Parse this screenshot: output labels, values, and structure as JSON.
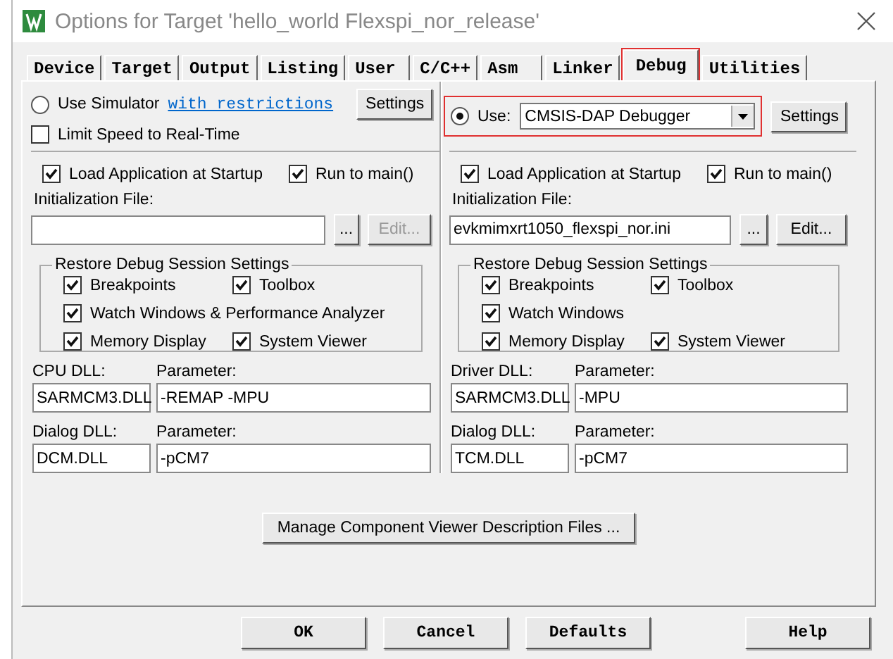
{
  "window": {
    "title": "Options for Target 'hello_world Flexspi_nor_release'"
  },
  "tabs": [
    {
      "label": "Device",
      "selected": false,
      "highlighted": false
    },
    {
      "label": "Target",
      "selected": false,
      "highlighted": false
    },
    {
      "label": "Output",
      "selected": false,
      "highlighted": false
    },
    {
      "label": "Listing",
      "selected": false,
      "highlighted": false
    },
    {
      "label": "User",
      "selected": false,
      "highlighted": false
    },
    {
      "label": "C/C++",
      "selected": false,
      "highlighted": false
    },
    {
      "label": "Asm",
      "selected": false,
      "highlighted": false
    },
    {
      "label": "Linker",
      "selected": false,
      "highlighted": false
    },
    {
      "label": "Debug",
      "selected": true,
      "highlighted": true
    },
    {
      "label": "Utilities",
      "selected": false,
      "highlighted": false
    }
  ],
  "columns": [
    {
      "top": {
        "kind": "simulator",
        "radio_label": "Use Simulator",
        "selected": false,
        "link": "with restrictions",
        "settings": "Settings",
        "limit_speed": {
          "label": "Limit Speed to Real-Time",
          "checked": false
        }
      },
      "load_app": {
        "label": "Load Application at Startup",
        "checked": true
      },
      "run_to_main": {
        "label": "Run to main()",
        "checked": true
      },
      "init_file": {
        "label": "Initialization File:",
        "browse": "...",
        "edit": {
          "label": "Edit...",
          "disabled": true
        }
      },
      "restore": {
        "title": "Restore Debug Session Settings",
        "items": [
          {
            "label": "Breakpoints",
            "checked": true
          },
          {
            "label": "Toolbox",
            "checked": true
          },
          {
            "label": "Watch Windows & Performance Analyzer",
            "checked": true
          },
          {
            "label": "Memory Display",
            "checked": true
          },
          {
            "label": "System Viewer",
            "checked": true
          }
        ]
      },
      "dll_rows": [
        {
          "dll_label": "CPU DLL:",
          "dll": "SARMCM3.DLL",
          "param_label": "Parameter:",
          "param": "-REMAP -MPU"
        },
        {
          "dll_label": "Dialog DLL:",
          "dll": "DCM.DLL",
          "param_label": "Parameter:",
          "param": "-pCM7"
        }
      ]
    },
    {
      "top": {
        "kind": "driver",
        "radio_label": "Use:",
        "selected": true,
        "highlighted": true,
        "dropdown": "CMSIS-DAP Debugger",
        "settings": "Settings"
      },
      "load_app": {
        "label": "Load Application at Startup",
        "checked": true
      },
      "run_to_main": {
        "label": "Run to main()",
        "checked": true
      },
      "init_file": {
        "label": "Initialization File:",
        "value": "evkmimxrt1050_flexspi_nor.ini",
        "browse": "...",
        "edit": {
          "label": "Edit...",
          "disabled": false
        }
      },
      "restore": {
        "title": "Restore Debug Session Settings",
        "items": [
          {
            "label": "Breakpoints",
            "checked": true
          },
          {
            "label": "Toolbox",
            "checked": true
          },
          {
            "label": "Watch Windows",
            "checked": true
          },
          {
            "label": "Memory Display",
            "checked": true
          },
          {
            "label": "System Viewer",
            "checked": true
          }
        ]
      },
      "dll_rows": [
        {
          "dll_label": "Driver DLL:",
          "dll": "SARMCM3.DLL",
          "param_label": "Parameter:",
          "param": "-MPU"
        },
        {
          "dll_label": "Dialog DLL:",
          "dll": "TCM.DLL",
          "param_label": "Parameter:",
          "param": "-pCM7"
        }
      ]
    }
  ],
  "manage_button": "Manage Component Viewer Description Files ...",
  "buttons": [
    "OK",
    "Cancel",
    "Defaults",
    "Help"
  ]
}
